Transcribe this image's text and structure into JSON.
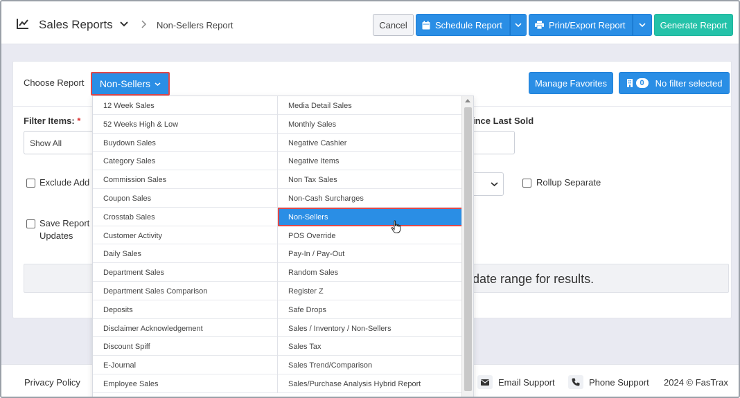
{
  "header": {
    "title": "Sales Reports",
    "breadcrumb": "Non-Sellers Report",
    "cancel_label": "Cancel",
    "schedule_label": "Schedule Report",
    "print_label": "Print/Export Report",
    "generate_label": "Generate Report"
  },
  "toolbar": {
    "choose_label": "Choose Report",
    "selected_report": "Non-Sellers",
    "favorites_label": "Manage Favorites",
    "filter_count": "0",
    "filter_label": "No filter selected"
  },
  "form": {
    "filter_items_label": "Filter Items:",
    "required_mark": "*",
    "filter_value": "Show All",
    "since_last_sold_label": "ince Last Sold",
    "exclude_label": "Exclude Add",
    "rollup_label": "Rollup Separate",
    "save_report_label": "Save Report",
    "save_report_label2": "Updates",
    "results_text": "date range for results."
  },
  "menu": {
    "left": [
      "12 Week Sales",
      "52 Weeks High & Low",
      "Buydown Sales",
      "Category Sales",
      "Commission Sales",
      "Coupon Sales",
      "Crosstab Sales",
      "Customer Activity",
      "Daily Sales",
      "Department Sales",
      "Department Sales Comparison",
      "Deposits",
      "Disclaimer Acknowledgement",
      "Discount Spiff",
      "E-Journal",
      "Employee Sales"
    ],
    "right": [
      "Media Detail Sales",
      "Monthly Sales",
      "Negative Cashier",
      "Negative Items",
      "Non Tax Sales",
      "Non-Cash Surcharges",
      "Non-Sellers",
      "POS Override",
      "Pay-In / Pay-Out",
      "Random Sales",
      "Register Z",
      "Safe Drops",
      "Sales / Inventory / Non-Sellers",
      "Sales Tax",
      "Sales Trend/Comparison",
      "Sales/Purchase Analysis Hybrid Report"
    ],
    "active": "Non-Sellers"
  },
  "footer": {
    "privacy": "Privacy Policy",
    "email_support": "Email Support",
    "phone_support": "Phone Support",
    "copyright": "2024 © FasTrax"
  },
  "colors": {
    "primary": "#2a8ee5",
    "generate": "#24c2a9",
    "highlight_border": "#e0484a"
  }
}
